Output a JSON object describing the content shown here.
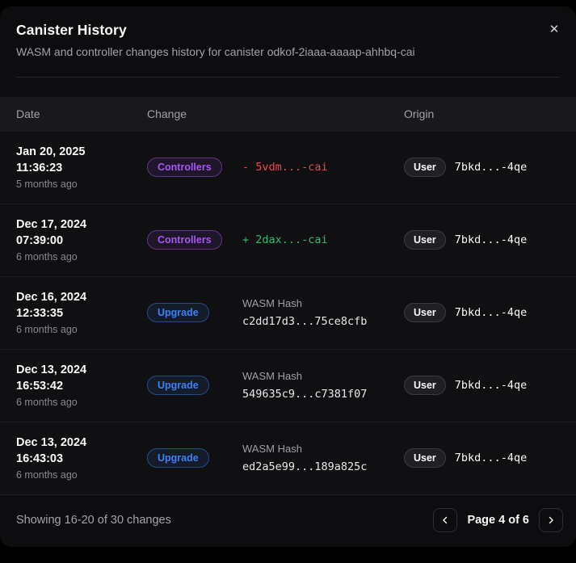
{
  "modal": {
    "title": "Canister History",
    "subtitle": "WASM and controller changes history for canister odkof-2iaaa-aaaap-ahhbq-cai",
    "close_glyph": "✕"
  },
  "table": {
    "columns": [
      "Date",
      "Change",
      "Origin"
    ],
    "rows": [
      {
        "date": "Jan 20, 2025",
        "time": "11:36:23",
        "relative": "5 months ago",
        "change_type": "Controllers",
        "change_kind": "controller-removed",
        "change_value": "- 5vdm...-cai",
        "origin_label": "User",
        "origin_value": "7bkd...-4qe"
      },
      {
        "date": "Dec 17, 2024",
        "time": "07:39:00",
        "relative": "6 months ago",
        "change_type": "Controllers",
        "change_kind": "controller-added",
        "change_value": "+ 2dax...-cai",
        "origin_label": "User",
        "origin_value": "7bkd...-4qe"
      },
      {
        "date": "Dec 16, 2024",
        "time": "12:33:35",
        "relative": "6 months ago",
        "change_type": "Upgrade",
        "change_kind": "upgrade",
        "change_label": "WASM Hash",
        "change_value": "c2dd17d3...75ce8cfb",
        "origin_label": "User",
        "origin_value": "7bkd...-4qe"
      },
      {
        "date": "Dec 13, 2024",
        "time": "16:53:42",
        "relative": "6 months ago",
        "change_type": "Upgrade",
        "change_kind": "upgrade",
        "change_label": "WASM Hash",
        "change_value": "549635c9...c7381f07",
        "origin_label": "User",
        "origin_value": "7bkd...-4qe"
      },
      {
        "date": "Dec 13, 2024",
        "time": "16:43:03",
        "relative": "6 months ago",
        "change_type": "Upgrade",
        "change_kind": "upgrade",
        "change_label": "WASM Hash",
        "change_value": "ed2a5e99...189a825c",
        "origin_label": "User",
        "origin_value": "7bkd...-4qe"
      }
    ]
  },
  "footer": {
    "summary": "Showing 16-20 of 30 changes",
    "page_label": "Page 4 of 6"
  },
  "colors": {
    "modal_background": "#0d0d0f",
    "table_header_background": "#19191c",
    "controllers_badge": "#a855f7",
    "upgrade_badge": "#3b82f6",
    "diff_removed": "#e5484d",
    "diff_added": "#2ebd6b",
    "text_primary": "#fafafa",
    "text_muted": "#a1a1aa"
  }
}
